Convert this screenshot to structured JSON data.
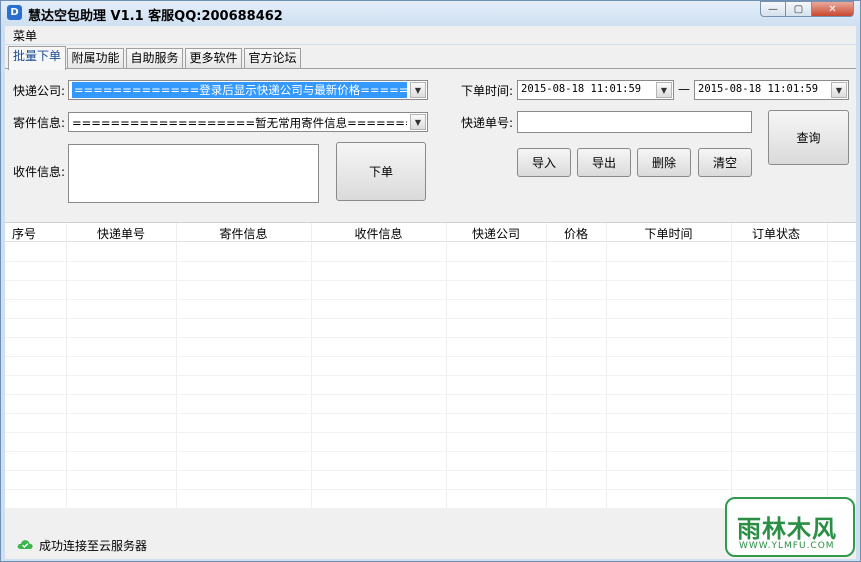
{
  "window": {
    "title": "慧达空包助理 V1.1 客服QQ:200688462",
    "icon": "app-logo-icon",
    "controls": [
      "minimize",
      "restore",
      "close"
    ]
  },
  "menubar": {
    "items": [
      "菜单"
    ]
  },
  "tabs": [
    {
      "label": "批量下单",
      "active": true
    },
    {
      "label": "附属功能",
      "active": false
    },
    {
      "label": "自助服务",
      "active": false
    },
    {
      "label": "更多软件",
      "active": false
    },
    {
      "label": "官方论坛",
      "active": false
    }
  ],
  "form": {
    "courier_label": "快递公司:",
    "courier_value": "=============登录后显示快递公司与最新价格=============",
    "sender_label": "寄件信息:",
    "sender_value": "===================暂无常用寄件信息===================",
    "receiver_label": "收件信息:",
    "receiver_value": "",
    "order_time_label": "下单时间:",
    "date_from": "2015-08-18  11:01:59",
    "date_sep": "—",
    "date_to": "2015-08-18  11:01:59",
    "tracking_label": "快递单号:",
    "tracking_value": "",
    "buttons": {
      "place_order": "下单",
      "query": "查询",
      "import": "导入",
      "export": "导出",
      "delete": "删除",
      "clear": "清空"
    }
  },
  "table": {
    "columns": [
      "序号",
      "快递单号",
      "寄件信息",
      "收件信息",
      "快递公司",
      "价格",
      "下单时间",
      "订单状态"
    ],
    "rows": []
  },
  "status": {
    "icon": "cloud-check-icon",
    "text": "成功连接至云服务器"
  },
  "watermark": {
    "main": "雨林木风",
    "sub": "WWW.YLMFU.COM"
  },
  "colors": {
    "selection": "#3399ff",
    "active_tab_text": "#1a4a90",
    "watermark_green": "#2a8f44",
    "status_icon_green": "#3ab54a"
  }
}
